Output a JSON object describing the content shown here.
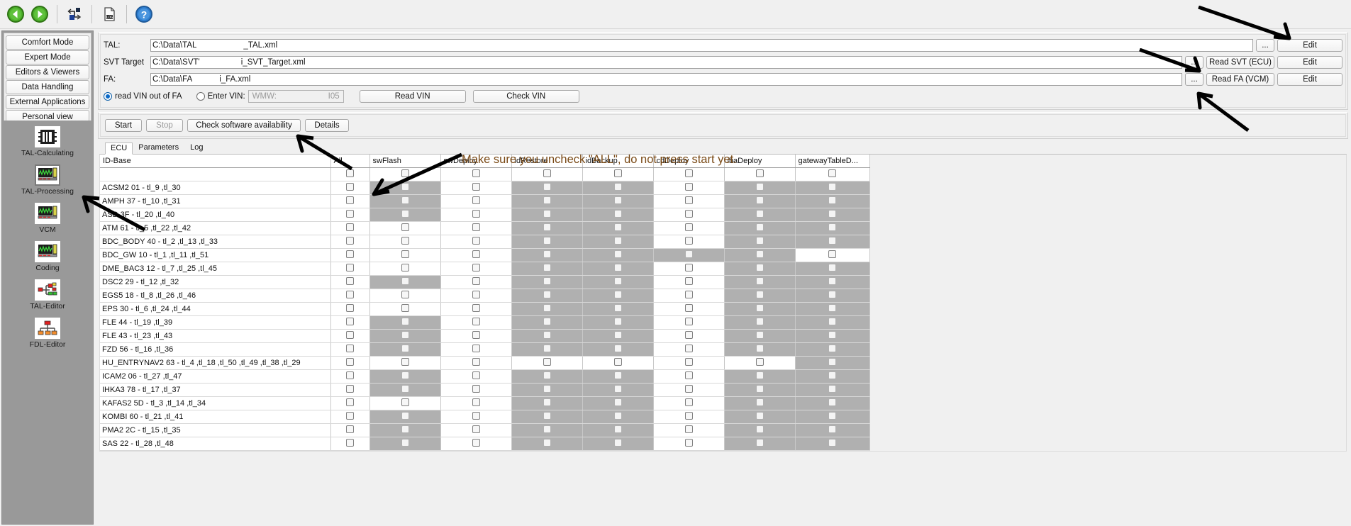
{
  "toolbar": {
    "buttons": [
      {
        "name": "back-icon",
        "title": "Back"
      },
      {
        "name": "forward-icon",
        "title": "Forward"
      },
      {
        "name": "network-flow-icon",
        "title": "Connection"
      },
      {
        "name": "log-document-icon",
        "title": "Log"
      },
      {
        "name": "help-icon",
        "title": "Help"
      }
    ]
  },
  "sidebar": {
    "modes": [
      {
        "label": "Comfort Mode"
      },
      {
        "label": "Expert Mode"
      },
      {
        "label": "Editors & Viewers"
      },
      {
        "label": "Data Handling"
      },
      {
        "label": "External Applications"
      },
      {
        "label": "Personal view"
      }
    ],
    "tools": [
      {
        "label": "TAL-Calculating",
        "icon": "chip-icon",
        "selected": false
      },
      {
        "label": "TAL-Processing",
        "icon": "waveform-monitor-icon",
        "selected": true
      },
      {
        "label": "VCM",
        "icon": "waveform-monitor-icon",
        "selected": false
      },
      {
        "label": "Coding",
        "icon": "waveform-monitor-icon",
        "selected": false
      },
      {
        "label": "TAL-Editor",
        "icon": "tree-nodes-icon",
        "selected": false
      },
      {
        "label": "FDL-Editor",
        "icon": "tree-nodes-icon",
        "selected": false
      }
    ]
  },
  "files": {
    "tal": {
      "label": "TAL:",
      "path_prefix": "C:\\Data\\TAL",
      "path_suffix": "_TAL.xml",
      "dots": "...",
      "edit": "Edit"
    },
    "svt": {
      "label": "SVT Target",
      "path_prefix": "C:\\Data\\SVT'",
      "path_suffix": "i_SVT_Target.xml",
      "dots": "...",
      "read": "Read SVT (ECU)",
      "edit": "Edit"
    },
    "fa": {
      "label": "FA:",
      "path_prefix": "C:\\Data\\FA",
      "path_suffix": "i_FA.xml",
      "dots": "...",
      "read": "Read FA (VCM)",
      "edit": "Edit"
    }
  },
  "vin": {
    "read_out_of_fa_label": "read VIN out of FA",
    "enter_vin_label": "Enter VIN:",
    "vin_prefix": "WMW:",
    "vin_suffix": "I05",
    "read_vin_button": "Read VIN",
    "check_vin_button": "Check VIN",
    "selected": "read_out_of_fa"
  },
  "actions": {
    "start": "Start",
    "stop": "Stop",
    "check_software": "Check software availability",
    "details": "Details"
  },
  "tabs": [
    {
      "label": "ECU",
      "active": true
    },
    {
      "label": "Parameters",
      "active": false
    },
    {
      "label": "Log",
      "active": false
    }
  ],
  "table": {
    "columns": [
      "ID-Base",
      "All",
      "swFlash",
      "swDeploy",
      "idRestore",
      "idBackup",
      "cdDeploy",
      "ibaDeploy",
      "gatewayTableD..."
    ],
    "header_row_checks": [
      true,
      true,
      true,
      true,
      true,
      true,
      true,
      true
    ],
    "rows": [
      {
        "name": "ACSM2 01 - tl_9 ,tl_30",
        "cells": [
          "w",
          "g",
          "w",
          "g",
          "g",
          "w",
          "g",
          "g"
        ]
      },
      {
        "name": "AMPH 37 - tl_10 ,tl_31",
        "cells": [
          "w",
          "g",
          "w",
          "g",
          "g",
          "w",
          "g",
          "g"
        ]
      },
      {
        "name": "ASD 3F - tl_20 ,tl_40",
        "cells": [
          "w",
          "g",
          "w",
          "g",
          "g",
          "w",
          "g",
          "g"
        ]
      },
      {
        "name": "ATM 61 - tl_5 ,tl_22 ,tl_42",
        "cells": [
          "w",
          "w",
          "w",
          "g",
          "g",
          "w",
          "g",
          "g"
        ]
      },
      {
        "name": "BDC_BODY 40 - tl_2 ,tl_13 ,tl_33",
        "cells": [
          "w",
          "w",
          "w",
          "g",
          "g",
          "w",
          "g",
          "g"
        ]
      },
      {
        "name": "BDC_GW 10 - tl_1 ,tl_11 ,tl_51",
        "cells": [
          "w",
          "w",
          "w",
          "g",
          "g",
          "g",
          "g",
          "w"
        ]
      },
      {
        "name": "DME_BAC3 12 - tl_7 ,tl_25 ,tl_45",
        "cells": [
          "w",
          "w",
          "w",
          "g",
          "g",
          "w",
          "g",
          "g"
        ]
      },
      {
        "name": "DSC2 29 - tl_12 ,tl_32",
        "cells": [
          "w",
          "g",
          "w",
          "g",
          "g",
          "w",
          "g",
          "g"
        ]
      },
      {
        "name": "EGS5 18 - tl_8 ,tl_26 ,tl_46",
        "cells": [
          "w",
          "w",
          "w",
          "g",
          "g",
          "w",
          "g",
          "g"
        ]
      },
      {
        "name": "EPS 30 - tl_6 ,tl_24 ,tl_44",
        "cells": [
          "w",
          "w",
          "w",
          "g",
          "g",
          "w",
          "g",
          "g"
        ]
      },
      {
        "name": "FLE 44 - tl_19 ,tl_39",
        "cells": [
          "w",
          "g",
          "w",
          "g",
          "g",
          "w",
          "g",
          "g"
        ]
      },
      {
        "name": "FLE 43 - tl_23 ,tl_43",
        "cells": [
          "w",
          "g",
          "w",
          "g",
          "g",
          "w",
          "g",
          "g"
        ]
      },
      {
        "name": "FZD 56 - tl_16 ,tl_36",
        "cells": [
          "w",
          "g",
          "w",
          "g",
          "g",
          "w",
          "g",
          "g"
        ]
      },
      {
        "name": "HU_ENTRYNAV2 63 - tl_4 ,tl_18 ,tl_50 ,tl_49 ,tl_38 ,tl_29",
        "cells": [
          "w",
          "w",
          "w",
          "w",
          "w",
          "w",
          "w",
          "g"
        ]
      },
      {
        "name": "ICAM2 06 - tl_27 ,tl_47",
        "cells": [
          "w",
          "g",
          "w",
          "g",
          "g",
          "w",
          "g",
          "g"
        ]
      },
      {
        "name": "IHKA3 78 - tl_17 ,tl_37",
        "cells": [
          "w",
          "g",
          "w",
          "g",
          "g",
          "w",
          "g",
          "g"
        ]
      },
      {
        "name": "KAFAS2 5D - tl_3 ,tl_14 ,tl_34",
        "cells": [
          "w",
          "w",
          "w",
          "g",
          "g",
          "w",
          "g",
          "g"
        ]
      },
      {
        "name": "KOMBI 60 - tl_21 ,tl_41",
        "cells": [
          "w",
          "g",
          "w",
          "g",
          "g",
          "w",
          "g",
          "g"
        ]
      },
      {
        "name": "PMA2 2C - tl_15 ,tl_35",
        "cells": [
          "w",
          "g",
          "w",
          "g",
          "g",
          "w",
          "g",
          "g"
        ]
      },
      {
        "name": "SAS 22 - tl_28 ,tl_48",
        "cells": [
          "w",
          "g",
          "w",
          "g",
          "g",
          "w",
          "g",
          "g"
        ]
      }
    ]
  },
  "annotation": {
    "text": "Make sure you uncheck \"ALL\", do not press start yet.",
    "color": "#7a4a16"
  }
}
